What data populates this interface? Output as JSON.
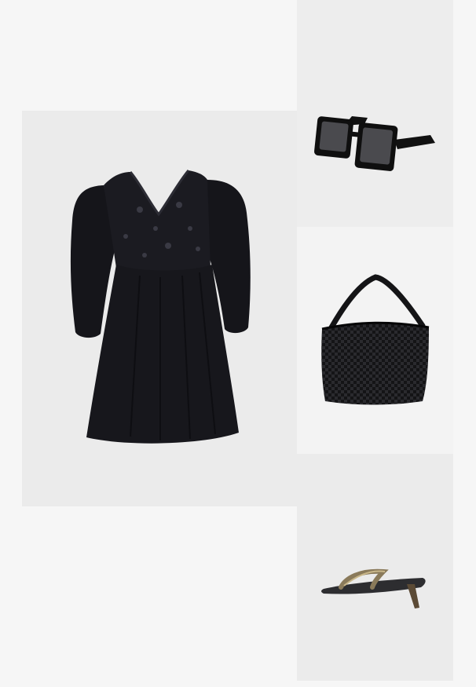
{
  "collage": {
    "background": "#f6f6f6",
    "items": [
      {
        "id": "dress",
        "icon": "black-mini-dress-icon",
        "tile_color": "#ebebeb"
      },
      {
        "id": "sunglasses",
        "icon": "black-square-sunglasses-icon",
        "tile_color": "#ededed"
      },
      {
        "id": "bag",
        "icon": "black-woven-shoulder-bag-icon",
        "tile_color": "#f3f3f3"
      },
      {
        "id": "sandal",
        "icon": "kitten-heel-thong-sandal-icon",
        "tile_color": "#ebebeb"
      }
    ]
  }
}
